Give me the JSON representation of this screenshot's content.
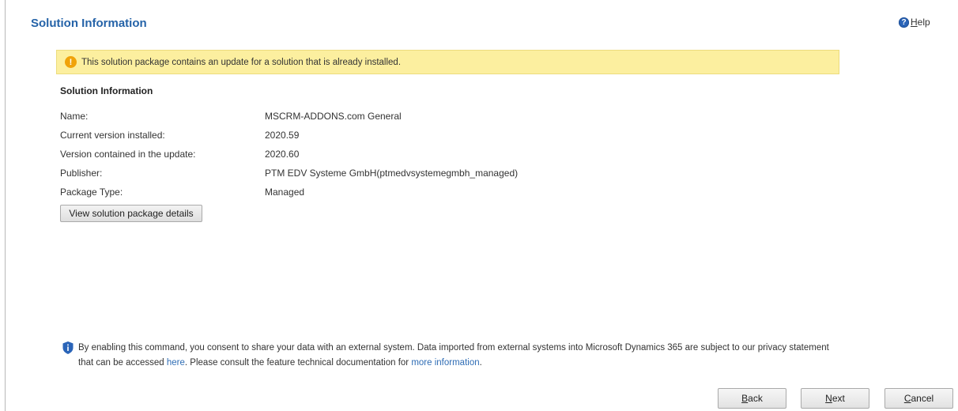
{
  "header": {
    "title": "Solution Information",
    "help_label_first": "H",
    "help_label_rest": "elp"
  },
  "warning": {
    "text": "This solution package contains an update for a solution that is already installed."
  },
  "section": {
    "heading": "Solution Information",
    "rows": [
      {
        "label": "Name:",
        "value": "MSCRM-ADDONS.com General"
      },
      {
        "label": "Current version installed:",
        "value": "2020.59"
      },
      {
        "label": "Version contained in the update:",
        "value": "2020.60"
      },
      {
        "label": "Publisher:",
        "value": "PTM EDV Systeme GmbH(ptmedvsystemegmbh_managed)"
      },
      {
        "label": "Package Type:",
        "value": "Managed"
      }
    ],
    "details_button": "View solution package details"
  },
  "consent": {
    "text_1": "By enabling this command, you consent to share your data with an external system. Data imported from external systems into Microsoft Dynamics 365 are subject to our privacy statement that can be accessed ",
    "link_here": "here",
    "text_2": ". Please consult the feature technical documentation for ",
    "link_more": "more information",
    "text_3": "."
  },
  "footer": {
    "back": {
      "first": "B",
      "rest": "ack"
    },
    "next": {
      "first": "N",
      "rest": "ext"
    },
    "cancel": {
      "first": "C",
      "rest": "ancel"
    }
  },
  "colors": {
    "title": "#2563a8",
    "warning_bg": "#fcef9f",
    "warning_icon": "#f0a30a",
    "link": "#2f6db5",
    "help_icon": "#2a64b8"
  }
}
